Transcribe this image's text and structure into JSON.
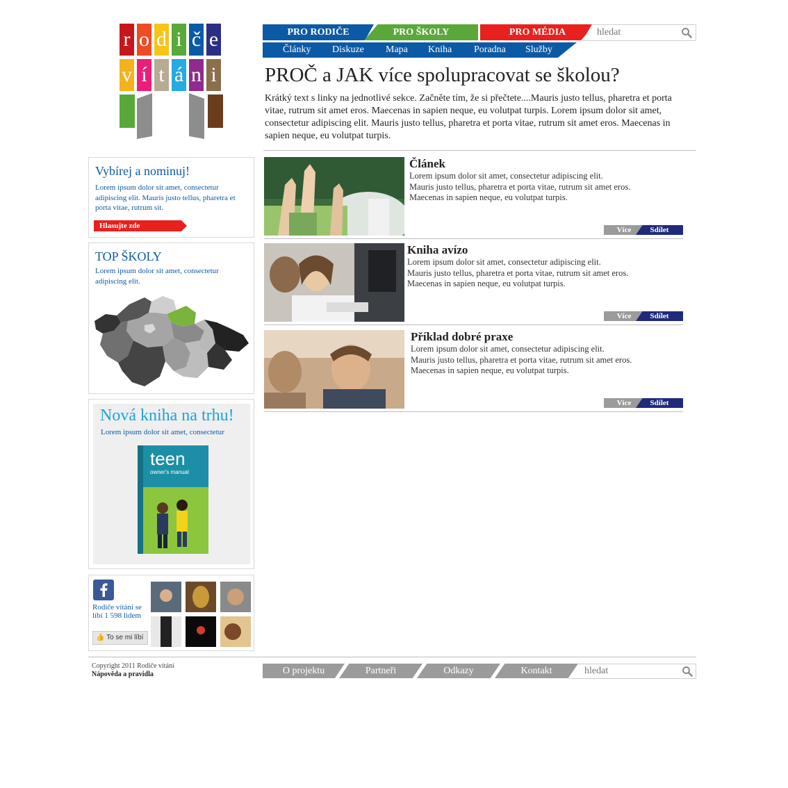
{
  "logo": {
    "row1": [
      "r",
      "o",
      "d",
      "i",
      "č",
      "e"
    ],
    "row2": [
      "v",
      "í",
      "t",
      "á",
      "n",
      "i"
    ],
    "row1_colors": [
      "#c8161d",
      "#ef4b24",
      "#f5c518",
      "#5aa83a",
      "#0c5aa6",
      "#2b2f83"
    ],
    "row2_colors": [
      "#f5b21b",
      "#ec1e79",
      "#b7ab94",
      "#27a9e1",
      "#8e2b8c",
      "#8a6f4a"
    ]
  },
  "nav": {
    "main": [
      {
        "label": "PRO RODIČE",
        "color": "#0c5aa6"
      },
      {
        "label": "PRO ŠKOLY",
        "color": "#5aa83a"
      },
      {
        "label": "PRO MÉDIA",
        "color": "#e8211e"
      }
    ],
    "sub": [
      "Články",
      "Diskuze",
      "Mapa",
      "Kniha",
      "Poradna",
      "Služby"
    ],
    "search_placeholder": "hledat"
  },
  "main": {
    "title": "PROČ a JAK více spolupracovat se školou?",
    "intro": "Krátký text s linky na jednotlivé sekce. Začněte tím, že si přečtete....Mauris justo tellus, pharetra et porta vitae, rutrum sit amet eros. Maecenas in sapien neque, eu volutpat turpis.  Lorem ipsum dolor sit amet, consectetur adipiscing elit. Mauris justo tellus, pharetra et porta vitae, rutrum sit amet eros. Maecenas in sapien neque, eu volutpat turpis.",
    "articles": [
      {
        "title": "Článek",
        "lines": [
          "Lorem ipsum dolor sit amet, consectetur adipiscing elit.",
          "Mauris justo tellus, pharetra et porta vitae, rutrum sit amet eros.",
          "Maecenas in sapien neque, eu volutpat turpis."
        ],
        "more": "Více",
        "share": "Sdílet"
      },
      {
        "title": "Kniha avízo",
        "lines": [
          "Lorem ipsum dolor sit amet, consectetur adipiscing elit.",
          "Mauris justo tellus, pharetra et porta vitae, rutrum sit amet eros.",
          "Maecenas in sapien neque, eu volutpat turpis."
        ],
        "more": "Více",
        "share": "Sdílet"
      },
      {
        "title": "Příklad dobré praxe",
        "lines": [
          "Lorem ipsum dolor sit amet, consectetur adipiscing elit.",
          "Mauris justo tellus, pharetra et porta vitae, rutrum sit amet eros.",
          "Maecenas in sapien neque, eu volutpat turpis."
        ],
        "more": "Více",
        "share": "Sdílet"
      }
    ]
  },
  "sidebar": {
    "vote": {
      "title": "Vybírej a nominuj!",
      "text": "Lorem ipsum dolor sit amet, consectetur adipiscing elit. Mauris justo tellus, pharetra et porta vitae, rutrum sit.",
      "button": "Hlasujte zde"
    },
    "top": {
      "title": "TOP ŠKOLY",
      "text": "Lorem ipsum dolor sit amet, consectetur adipiscing elit."
    },
    "book": {
      "title": "Nová kniha na trhu!",
      "text": "Lorem ipsum dolor sit amet, consectetur",
      "cover_title": "teen",
      "cover_subtitle": "owner's manual"
    },
    "facebook": {
      "text": "Rodiče vítání se líbí 1 598 lidem",
      "like": "To se mi líbí"
    }
  },
  "footer": {
    "copyright": "Copyright 2011 Rodiče vítání",
    "help": "Nápověda a pravidla",
    "links": [
      "O projektu",
      "Partneři",
      "Odkazy",
      "Kontakt"
    ],
    "search_placeholder": "hledat"
  }
}
